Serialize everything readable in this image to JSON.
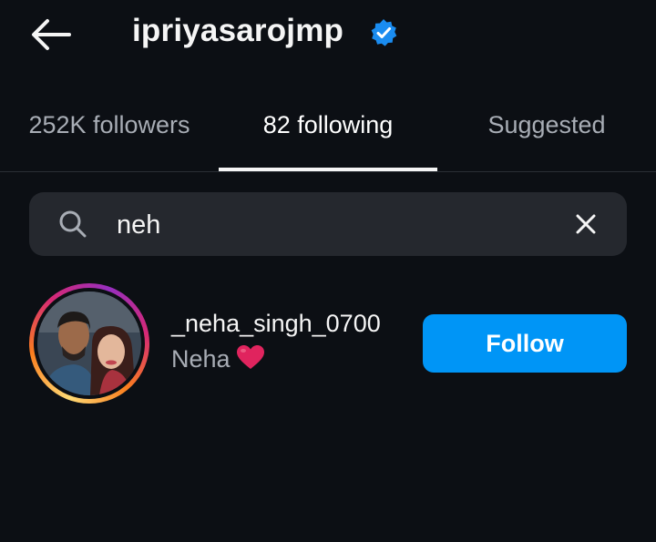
{
  "header": {
    "username": "ipriyasarojmp",
    "back_icon": "arrow-left-icon",
    "verified_icon": "verified-badge-icon"
  },
  "tabs": [
    {
      "label": "252K followers"
    },
    {
      "label": "82 following"
    },
    {
      "label": "Suggested"
    }
  ],
  "active_tab": 1,
  "search": {
    "value": "neh",
    "icon": "search-icon",
    "clear_icon": "close-icon"
  },
  "results": [
    {
      "username": "_neha_singh_0700",
      "full_name": "Neha",
      "emoji": "heart-icon",
      "button_label": "Follow"
    }
  ],
  "colors": {
    "background": "#0c0f14",
    "primary_button": "#0095f6",
    "verified": "#1a8cf0",
    "heart": "#e0245e",
    "secondary_text": "#a8adb5",
    "search_bg": "#25282e"
  }
}
